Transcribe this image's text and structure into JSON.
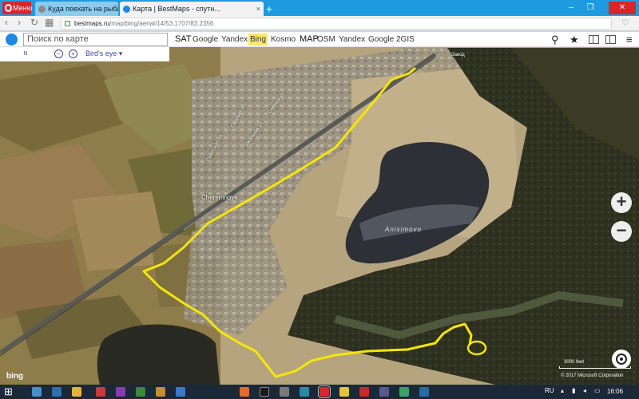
{
  "browser": {
    "menu_label": "Меню",
    "tabs": [
      {
        "title": "Куда поехать на рыбалку",
        "active": false
      },
      {
        "title": "Карта | BestMaps - спутн...",
        "active": true
      }
    ],
    "url_host": "bestmaps.ru",
    "url_path": "/map/bing/aerial/14/53.1707/83.2356"
  },
  "map_toolbar": {
    "search_placeholder": "Поиск по карте",
    "sat_label": "SAT",
    "sat_providers": [
      "Google",
      "Yandex",
      "Bing",
      "Kosmo"
    ],
    "selected_provider": "Bing",
    "map_label": "MAP",
    "map_providers": [
      "OSM",
      "Yandex",
      "Google",
      "2GIS"
    ],
    "compass_label": "N",
    "birds_eye_label": "Bird's eye ▾"
  },
  "map": {
    "labels": {
      "town": "Cheremnoye",
      "lake": "Anisimovo",
      "street1": "Садовая ул.",
      "street2": "Советская ул.",
      "street3": "Степная ул.",
      "street4": "Школьная ул.",
      "village": "Завод"
    },
    "zoom_in": "+",
    "zoom_out": "−",
    "scale_label": "3000 feet",
    "copyright": "© 2017 Microsoft Corporation",
    "provider_logo": "bing",
    "colors": {
      "route": "#f5e50a",
      "tilled_field": "#8a7440",
      "steppe": "#b8a176",
      "forest": "#2e2f1c",
      "lake": "#2e3138"
    }
  },
  "taskbar": {
    "lang": "RU",
    "time": "16:06"
  }
}
